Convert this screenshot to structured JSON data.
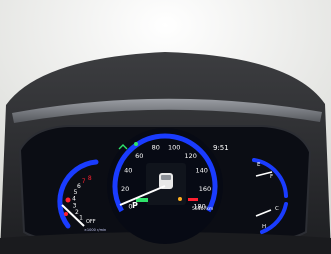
{
  "photo": {
    "subject": "car-instrument-cluster",
    "colors": {
      "backdrop": "#f4f4f2",
      "cowl": "#2a2b2e",
      "panel": "#0b0d14",
      "blue_ring": "#1a3cff",
      "red_zone": "#ff2030",
      "green": "#2fe36b",
      "white": "#ffffff",
      "amber": "#ffb020"
    }
  },
  "speedometer": {
    "unit": "km/h",
    "max": 180,
    "ticks": [
      "0",
      "20",
      "40",
      "60",
      "80",
      "100",
      "120",
      "140",
      "160",
      "180"
    ],
    "readout_time": "9:51",
    "gear": "P",
    "odometer": "56467km"
  },
  "tachometer": {
    "max": 8,
    "ticks": [
      "1",
      "2",
      "3",
      "4",
      "5",
      "6",
      "7",
      "8"
    ],
    "off_label": "OFF",
    "unit_label": "×1000 r/min"
  },
  "fuel_gauge": {
    "empty": "E",
    "full": "F"
  },
  "temp_gauge": {
    "cold": "C",
    "hot": "H"
  }
}
